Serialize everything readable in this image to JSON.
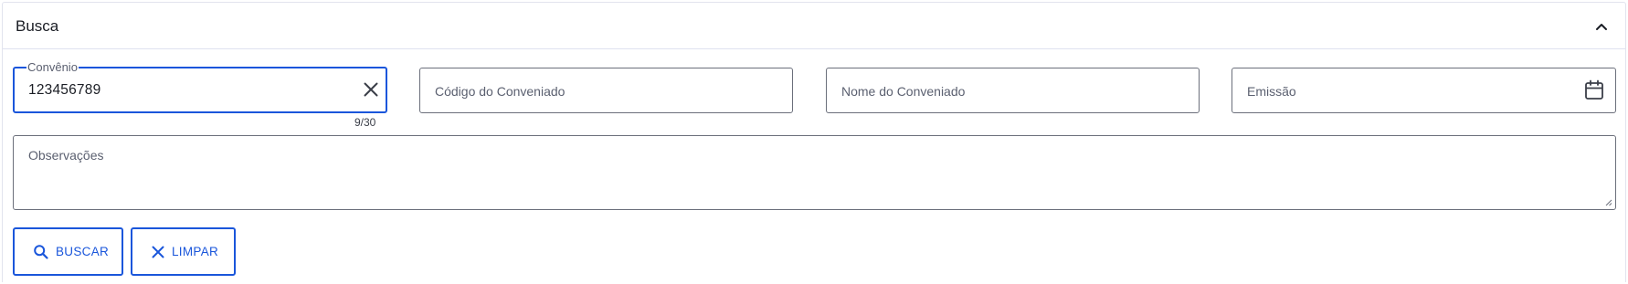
{
  "panel": {
    "title": "Busca"
  },
  "fields": {
    "convenio": {
      "label": "Convênio",
      "value": "123456789",
      "counter": "9/30"
    },
    "codigo_conveniado": {
      "placeholder": "Código do Conveniado"
    },
    "nome_conveniado": {
      "placeholder": "Nome do Conveniado"
    },
    "emissao": {
      "placeholder": "Emissão"
    },
    "observacoes": {
      "placeholder": "Observações"
    }
  },
  "actions": {
    "search_label": "BUSCAR",
    "clear_label": "LIMPAR"
  },
  "icons": {
    "collapse": "chevron-up-icon",
    "clear_field": "close-icon",
    "date": "calendar-icon",
    "search": "search-icon",
    "clear_button": "close-icon"
  },
  "colors": {
    "accent": "#1a56db",
    "border": "#6b6f7b",
    "divider": "#dfe1ef"
  }
}
